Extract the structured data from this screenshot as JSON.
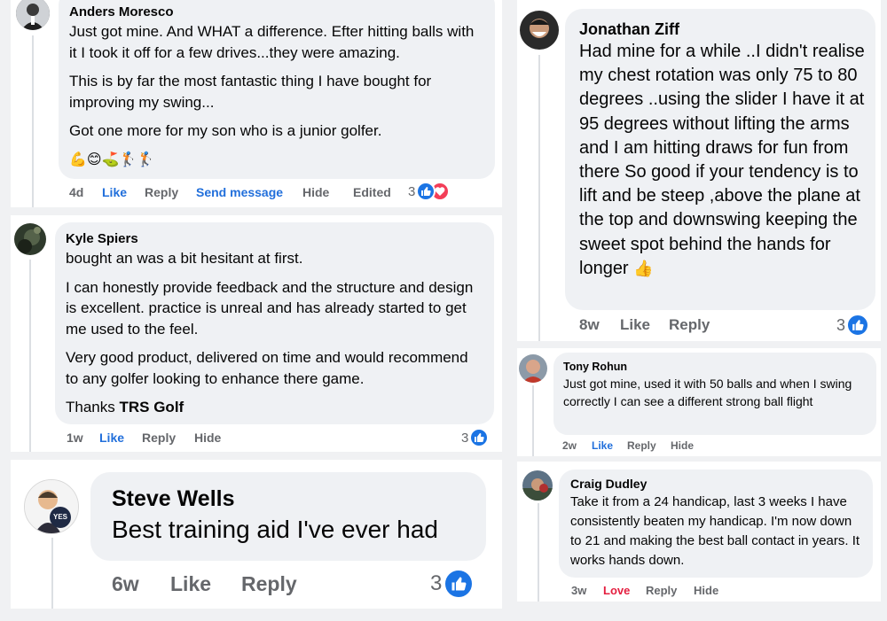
{
  "comments": [
    {
      "name": "Anders Moresco",
      "paragraphs": [
        "Just got mine. And WHAT a difference. Efter hitting balls with it I took it off for a few drives...they were amazing.",
        "This is by far the most fantastic thing I have bought for improving my swing...",
        "Got one more for my son who is a junior golfer."
      ],
      "emoji": "💪😊⛳🏌🏌",
      "time": "4d",
      "like": "Like",
      "reply": "Reply",
      "send": "Send message",
      "hide": "Hide",
      "edited": "Edited",
      "reactions": "3"
    },
    {
      "name": "Kyle Spiers",
      "paragraphs": [
        "bought an was a bit hesitant at first.",
        "I can honestly provide feedback and the structure and design is excellent. practice is unreal and has already started to get me used to the feel.",
        "Very good product, delivered on time and would recommend to any golfer looking to enhance there game."
      ],
      "thanks_prefix": "Thanks ",
      "thanks_bold": "TRS Golf",
      "time": "1w",
      "like": "Like",
      "reply": "Reply",
      "hide": "Hide",
      "reactions": "3"
    },
    {
      "name": "Steve Wells",
      "text": "Best training aid I've ever had",
      "avatar_badge": "YES",
      "time": "6w",
      "like": "Like",
      "reply": "Reply",
      "reactions": "3"
    },
    {
      "name": "Jonathan Ziff",
      "text": "Had mine for a while ..I didn't realise my chest rotation was only 75 to 80 degrees ..using the slider I have it at 95 degrees without lifting the arms and I am hitting draws for fun from there So good if your tendency is to lift and be steep ,above the plane at the top and downswing keeping the sweet spot behind the hands for longer",
      "emoji": "👍",
      "time": "8w",
      "like": "Like",
      "reply": "Reply",
      "reactions": "3"
    },
    {
      "name": "Tony Rohun",
      "text": "Just got mine, used it with 50 balls and when I swing correctly I can see a different strong ball flight",
      "time": "2w",
      "like": "Like",
      "reply": "Reply",
      "hide": "Hide"
    },
    {
      "name": "Craig Dudley",
      "text": "Take it from a 24 handicap, last 3 weeks I have consistently beaten my handicap. I'm now down to 21 and making the best ball contact in years. It works hands down.",
      "time": "3w",
      "like": "Love",
      "reply": "Reply",
      "hide": "Hide"
    }
  ],
  "colors": {
    "link_blue": "#216fdb",
    "love_red": "#e41e3f",
    "bubble": "#eff1f4",
    "meta_gray": "#65676b"
  }
}
